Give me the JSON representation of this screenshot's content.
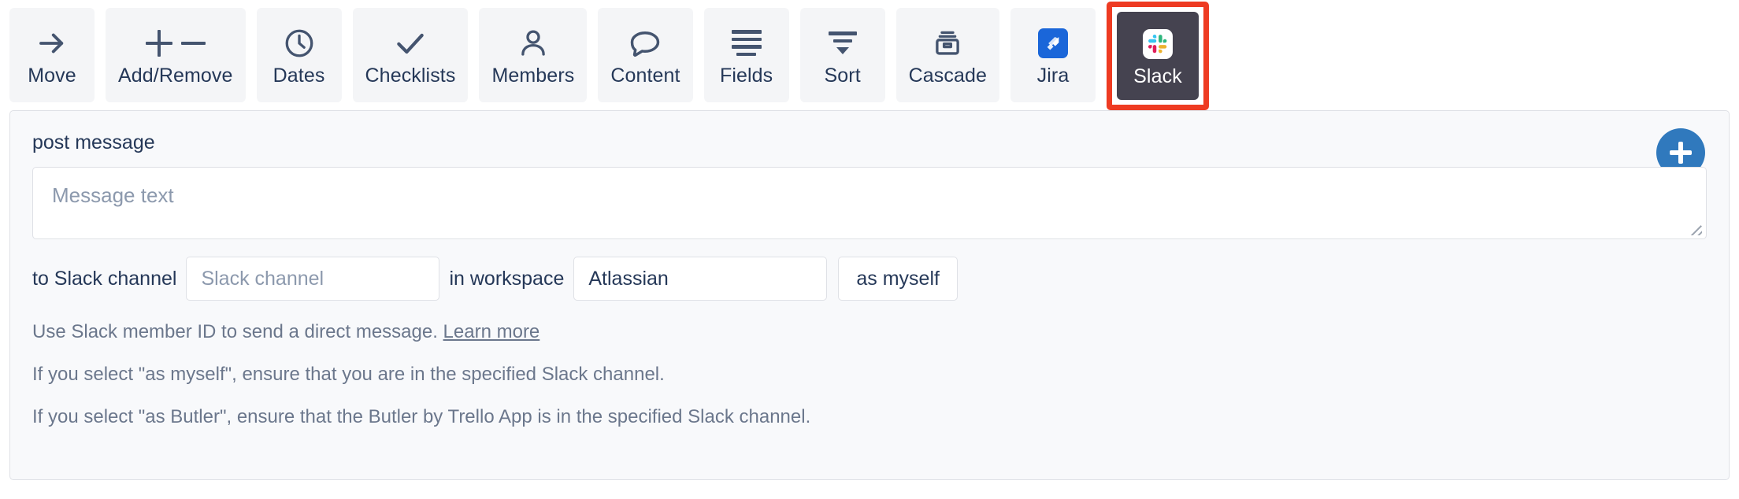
{
  "colors": {
    "tab_bg": "#f4f5f7",
    "tab_active_bg": "#454350",
    "highlight_border": "#ee3b22",
    "accent_blue": "#3079bd",
    "jira_blue": "#1a66d9",
    "text": "#253858",
    "muted_text": "#6b778c",
    "placeholder": "#8c99ad",
    "panel_bg": "#f8f9fb",
    "border": "#dfe1e6"
  },
  "tabbar": {
    "tabs": [
      {
        "label": "Move",
        "icon": "arrow-right-icon",
        "active": false,
        "highlighted": false
      },
      {
        "label": "Add/Remove",
        "icon": "plus-minus-icon",
        "active": false,
        "highlighted": false
      },
      {
        "label": "Dates",
        "icon": "clock-icon",
        "active": false,
        "highlighted": false
      },
      {
        "label": "Checklists",
        "icon": "checkmark-icon",
        "active": false,
        "highlighted": false
      },
      {
        "label": "Members",
        "icon": "person-icon",
        "active": false,
        "highlighted": false
      },
      {
        "label": "Content",
        "icon": "speech-bubble-icon",
        "active": false,
        "highlighted": false
      },
      {
        "label": "Fields",
        "icon": "lines-icon",
        "active": false,
        "highlighted": false
      },
      {
        "label": "Sort",
        "icon": "funnel-icon",
        "active": false,
        "highlighted": false
      },
      {
        "label": "Cascade",
        "icon": "archive-box-icon",
        "active": false,
        "highlighted": false
      },
      {
        "label": "Jira",
        "icon": "jira-logo-icon",
        "active": false,
        "highlighted": false
      },
      {
        "label": "Slack",
        "icon": "slack-logo-icon",
        "active": true,
        "highlighted": true
      }
    ]
  },
  "panel": {
    "title": "post message",
    "add_button": {
      "icon": "plus-icon",
      "label": "+"
    },
    "message": {
      "placeholder": "Message text",
      "value": ""
    },
    "row": {
      "label_to": "to Slack channel",
      "channel_placeholder": "Slack channel",
      "channel_value": "",
      "label_in": "in workspace",
      "workspace_value": "Atlassian",
      "identity_value": "as myself"
    },
    "help": {
      "line1_text": "Use Slack member ID to send a direct message. ",
      "line1_link": "Learn more",
      "line2": "If you select \"as myself\", ensure that you are in the specified Slack channel.",
      "line3": "If you select \"as Butler\", ensure that the Butler by Trello App is in the specified Slack channel."
    }
  }
}
